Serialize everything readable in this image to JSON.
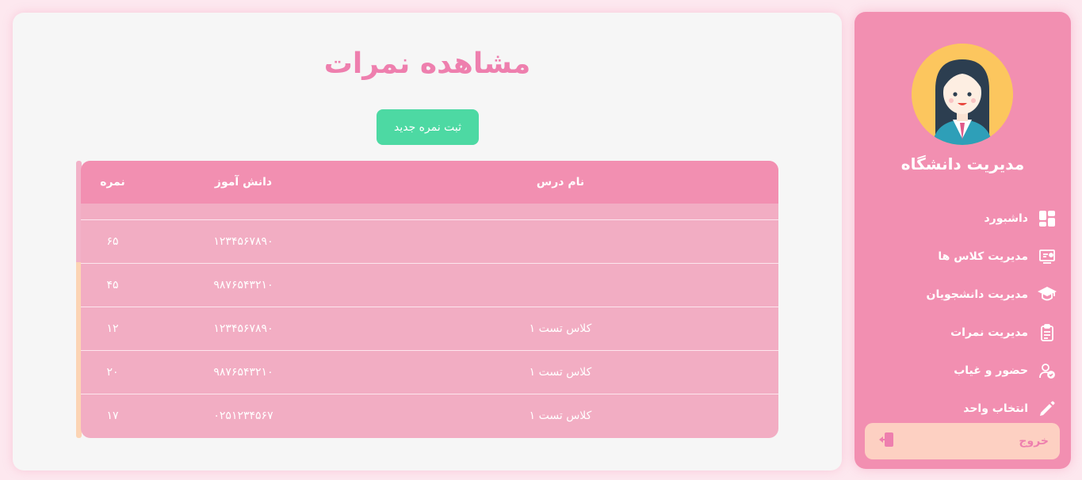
{
  "sidebar": {
    "brand": "مدیریت دانشگاه",
    "items": [
      {
        "label": "داشبورد",
        "icon": "dashboard-icon"
      },
      {
        "label": "مدیریت کلاس ها",
        "icon": "classroom-icon"
      },
      {
        "label": "مدیریت دانشجویان",
        "icon": "graduate-icon"
      },
      {
        "label": "مدیریت نمرات",
        "icon": "clipboard-icon"
      },
      {
        "label": "حضور و غیاب",
        "icon": "user-check-icon"
      },
      {
        "label": "انتخاب واحد",
        "icon": "pencil-icon"
      }
    ],
    "logout_label": "خروج"
  },
  "main": {
    "title": "مشاهده نمرات",
    "add_button": "ثبت نمره جدید",
    "table": {
      "headers": {
        "course": "نام درس",
        "student": "دانش آموز",
        "grade": "نمره"
      },
      "rows": [
        {
          "course": "",
          "student": "۱۲۳۴۵۶۷۸۹۰",
          "grade": "۶۵"
        },
        {
          "course": "",
          "student": "۹۸۷۶۵۴۳۲۱۰",
          "grade": "۴۵"
        },
        {
          "course": "کلاس تست ۱",
          "student": "۱۲۳۴۵۶۷۸۹۰",
          "grade": "۱۲"
        },
        {
          "course": "کلاس تست ۱",
          "student": "۹۸۷۶۵۴۳۲۱۰",
          "grade": "۲۰"
        },
        {
          "course": "کلاس تست ۱",
          "student": "۰۲۵۱۲۳۴۵۶۷",
          "grade": "۱۷"
        }
      ]
    }
  },
  "colors": {
    "sidebar": "#f28fb1",
    "accent_title": "#ee7fae",
    "add_button": "#4dd9a3",
    "table_body": "#f2adc3",
    "logout_bg": "#fdd0c2",
    "avatar_bg": "#fcc65e"
  }
}
